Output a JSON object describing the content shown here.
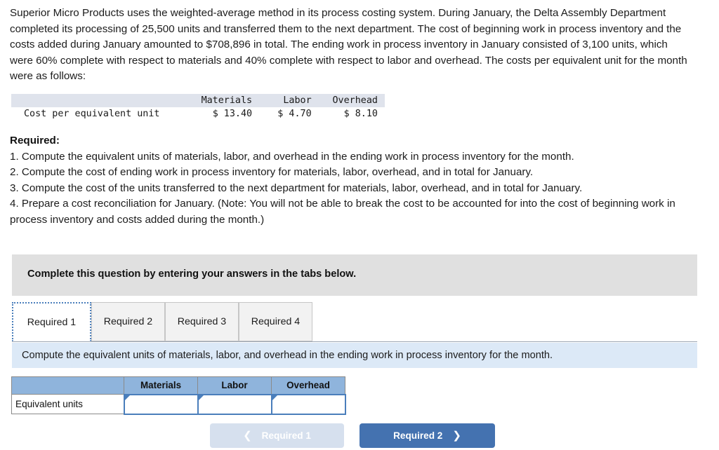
{
  "problem": {
    "statement": "Superior Micro Products uses the weighted-average method in its process costing system. During January, the Delta Assembly Department completed its processing of 25,500 units and transferred them to the next department. The cost of beginning work in process inventory and the costs added during January amounted to $708,896 in total. The ending work in process inventory in January consisted of 3,100 units, which were 60% complete with respect to materials and 40% complete with respect to labor and overhead. The costs per equivalent unit for the month were as follows:"
  },
  "cost_table": {
    "col_blank": "",
    "col_materials": "Materials",
    "col_labor": "Labor",
    "col_overhead": "Overhead",
    "row_label": "Cost per equivalent unit",
    "materials_value": "$ 13.40",
    "labor_value": "$ 4.70",
    "overhead_value": "$ 8.10"
  },
  "required": {
    "heading": "Required:",
    "items": [
      "1. Compute the equivalent units of materials, labor, and overhead in the ending work in process inventory for the month.",
      "2. Compute the cost of ending work in process inventory for materials, labor, overhead, and in total for January.",
      "3. Compute the cost of the units transferred to the next department for materials, labor, overhead, and in total for January.",
      "4. Prepare a cost reconciliation for January. (Note: You will not be able to break the cost to be accounted for into the cost of beginning work in process inventory and costs added during the month.)"
    ]
  },
  "banner": {
    "text": "Complete this question by entering your answers in the tabs below."
  },
  "tabs": {
    "items": [
      {
        "label": "Required 1",
        "active": true
      },
      {
        "label": "Required 2",
        "active": false
      },
      {
        "label": "Required 3",
        "active": false
      },
      {
        "label": "Required 4",
        "active": false
      }
    ]
  },
  "question_bar": {
    "text": "Compute the equivalent units of materials, labor, and overhead in the ending work in process inventory for the month."
  },
  "answer_grid": {
    "corner": "",
    "columns": [
      "Materials",
      "Labor",
      "Overhead"
    ],
    "row_label": "Equivalent units",
    "values": [
      "",
      "",
      ""
    ]
  },
  "nav": {
    "prev_label": "Required 1",
    "prev_icon": "chevron-left-icon",
    "next_label": "Required 2",
    "next_icon": "chevron-right-icon"
  },
  "colors": {
    "accent_blue": "#4472b0",
    "table_header_blue": "#8fb4dc",
    "question_bar_blue": "#dce9f7",
    "banner_gray": "#e0e0e0",
    "disabled_blue": "#d6e0ee",
    "cost_header_gray": "#dfe3ec"
  }
}
